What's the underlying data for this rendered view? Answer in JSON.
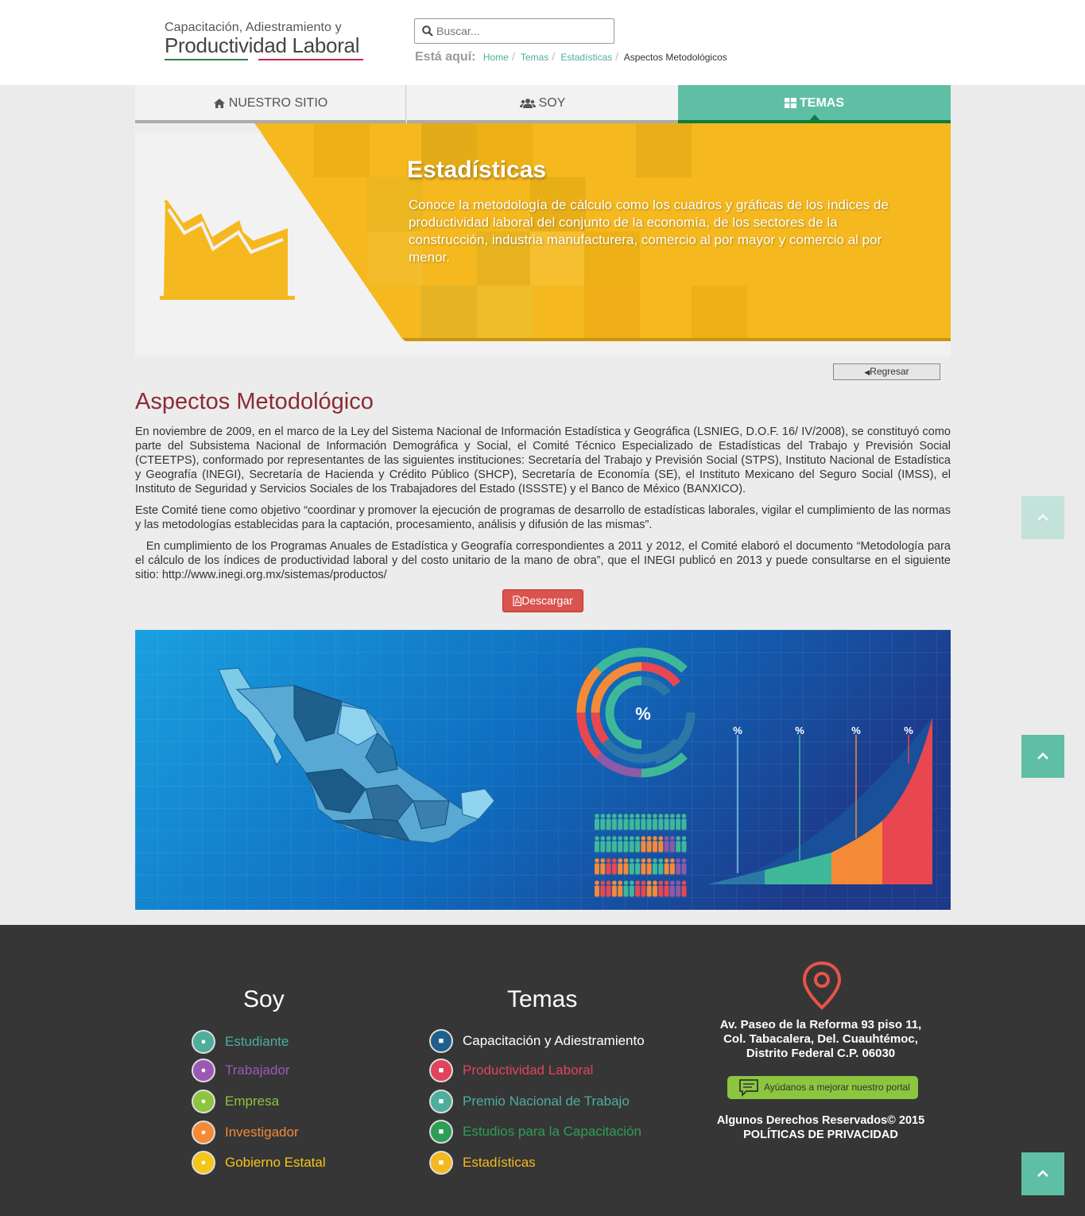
{
  "header": {
    "logo_line1": "Capacitación, Adiestramiento y",
    "logo_line2": "Productividad Laboral",
    "search_placeholder": "Buscar...",
    "breadcrumb_label": "Está aquí:",
    "breadcrumb": [
      "Home",
      "Temas",
      "Estadísticas",
      "Aspectos Metodológicos"
    ]
  },
  "nav": {
    "tabs": [
      {
        "label": "NUESTRO SITIO",
        "icon": "home-icon"
      },
      {
        "label": "SOY",
        "icon": "users-icon"
      },
      {
        "label": "TEMAS",
        "icon": "grid-icon",
        "active": true
      }
    ]
  },
  "banner": {
    "title": "Estadísticas",
    "description": "Conoce la metodología de cálculo como los cuadros y gráficas de los índices de productividad laboral del conjunto de la economía, de los sectores de la construcción, industria manufacturera, comercio al por mayor y comercio al por menor.",
    "icon": "area-chart-icon",
    "color": "#f5b81e"
  },
  "content": {
    "back_label": "Regresar",
    "title": "Aspectos Metodológico",
    "paragraphs": [
      "En noviembre de 2009, en el marco de la Ley del Sistema Nacional de Información Estadística y Geográfica (LSNIEG, D.O.F. 16/ IV/2008), se constituyó como parte del Subsistema Nacional de Información Demográfica y Social, el Comité Técnico Especializado de Estadísticas del Trabajo y Previsión Social (CTEETPS), conformado por representantes de las siguientes instituciones: Secretaría del Trabajo y Previsión Social (STPS), Instituto Nacional de Estadística y Geografía (INEGI), Secretaría de Hacienda y Crédito Público (SHCP), Secretaría de Economía (SE), el Instituto Mexicano del Seguro Social (IMSS), el Instituto de Seguridad y Servicios Sociales de los Trabajadores del Estado (ISSSTE) y el Banco de México (BANXICO).",
      "Este Comité tiene como objetivo “coordinar y promover la ejecución de programas de desarrollo de estadísticas laborales, vigilar el cumplimiento de las normas y las metodologías establecidas para la captación, procesamiento, análisis y difusión de las mismas”.",
      "   En cumplimiento de los Programas Anuales de Estadística y Geografía correspondientes a 2011 y 2012, el Comité elaboró el documento “Metodología para el cálculo de los índices de productividad laboral y del costo unitario de la mano de obra”, que el INEGI publicó en 2013 y puede consultarse en el siguiente sitio: http://www.inegi.org.mx/sistemas/productos/"
    ],
    "download_label": "Descargar"
  },
  "infographic": {
    "percent_label": "%",
    "bar_labels": [
      "%",
      "%",
      "%",
      "%"
    ]
  },
  "footer": {
    "soy": {
      "title": "Soy",
      "items": [
        {
          "label": "Estudiante",
          "color": "#4cae9b",
          "icon": "student-icon"
        },
        {
          "label": "Trabajador",
          "color": "#9b59b6",
          "icon": "worker-icon"
        },
        {
          "label": "Empresa",
          "color": "#8cc63f",
          "icon": "building-icon"
        },
        {
          "label": "Investigador",
          "color": "#f58a36",
          "icon": "researcher-icon"
        },
        {
          "label": "Gobierno Estatal",
          "color": "#f5c518",
          "icon": "government-icon"
        }
      ]
    },
    "temas": {
      "title": "Temas",
      "items": [
        {
          "label": "Capacitación y Adiestramiento",
          "color": "#ffffff",
          "icon": "training-icon",
          "circle": "#1f5f8b"
        },
        {
          "label": "Productividad Laboral",
          "color": "#e0435a",
          "icon": "productivity-icon",
          "circle": "#e0435a"
        },
        {
          "label": "Premio Nacional de Trabajo",
          "color": "#4cae9b",
          "icon": "award-icon",
          "circle": "#4cae9b"
        },
        {
          "label": "Estudios para la Capacitación",
          "color": "#2e9e55",
          "icon": "studies-icon",
          "circle": "#2e9e55"
        },
        {
          "label": "Estadísticas",
          "color": "#f5b81e",
          "icon": "statistics-icon",
          "circle": "#f5b81e"
        }
      ]
    },
    "address_lines": [
      "Av. Paseo de la Reforma 93 piso 11,",
      "Col. Tabacalera, Del. Cuauhtémoc,",
      "Distrito Federal C.P. 06030"
    ],
    "feedback_label": "Ayúdanos a mejorar nuestro portal",
    "rights": "Algunos Derechos Reservados© 2015",
    "privacy": "POLÍTICAS DE PRIVACIDAD"
  }
}
